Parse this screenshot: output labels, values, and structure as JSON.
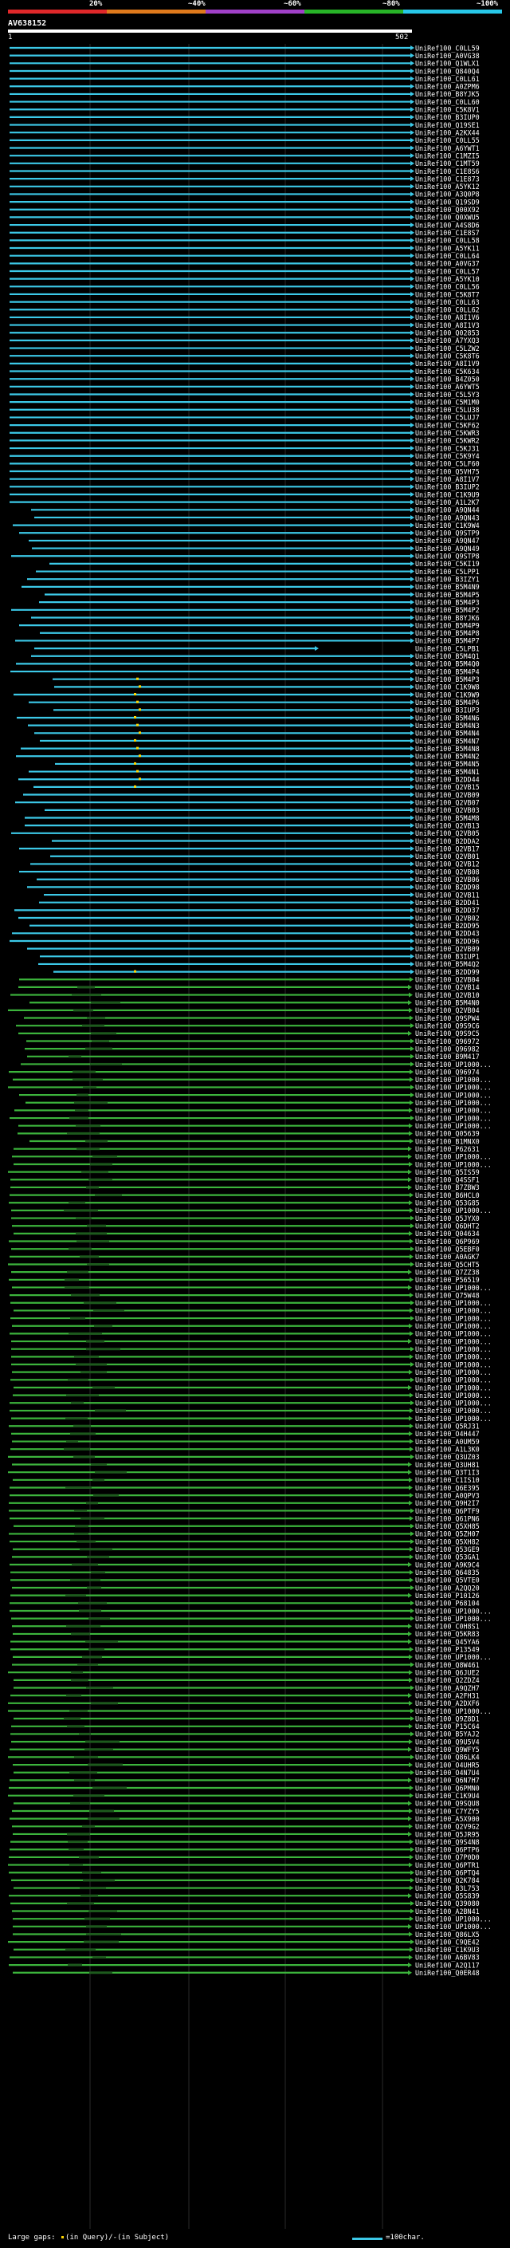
{
  "colorbar": {
    "ticks": [
      "20%",
      "~40%",
      "~60%",
      "~80%",
      "~100%"
    ],
    "colors": [
      "#e0282a",
      "#e07a1c",
      "#a040c8",
      "#28b428",
      "#28c8e8"
    ]
  },
  "query": {
    "title": "AV638152",
    "start": "1",
    "end": "502"
  },
  "colors": {
    "cyan": "#3cc9e8",
    "green": "#3cb43c",
    "dark_green": "#1d5a1d",
    "gap_dot": "#ffd700"
  },
  "hits": [
    "UniRef100_C0LL59",
    "UniRef100_A0VG38",
    "UniRef100_Q1WLX1",
    "UniRef100_Q840Q4",
    "UniRef100_C0LL61",
    "UniRef100_A0ZPM6",
    "UniRef100_B8YJK5",
    "UniRef100_C0LL60",
    "UniRef100_C5K8V1",
    "UniRef100_B3IUP0",
    "UniRef100_Q19SE1",
    "UniRef100_A2KX44",
    "UniRef100_C0LL55",
    "UniRef100_A6YWT1",
    "UniRef100_C1MZI5",
    "UniRef100_C1MT59",
    "UniRef100_C1E8S6",
    "UniRef100_C1E873",
    "UniRef100_A5YK12",
    "UniRef100_A3Q0P8",
    "UniRef100_Q19SD9",
    "UniRef100_Q00X92",
    "UniRef100_Q0XWU5",
    "UniRef100_A4S8D6",
    "UniRef100_C1E8S7",
    "UniRef100_C0LL58",
    "UniRef100_A5YK11",
    "UniRef100_C0LL64",
    "UniRef100_A0VG37",
    "UniRef100_C0LL57",
    "UniRef100_A5YK10",
    "UniRef100_C0LL56",
    "UniRef100_C5K8T7",
    "UniRef100_C0LL63",
    "UniRef100_C0LL62",
    "UniRef100_A8I1V6",
    "UniRef100_A8I1V3",
    "UniRef100_Q02853",
    "UniRef100_A7YXQ3",
    "UniRef100_C5LZW2",
    "UniRef100_C5K8T6",
    "UniRef100_A8I1V9",
    "UniRef100_C5K634",
    "UniRef100_B4Z050",
    "UniRef100_A6YWT5",
    "UniRef100_C5L5Y3",
    "UniRef100_C5M1M0",
    "UniRef100_C5LU38",
    "UniRef100_C5LUJ7",
    "UniRef100_C5KF62",
    "UniRef100_C5KWR3",
    "UniRef100_C5KWR2",
    "UniRef100_C5KJ31",
    "UniRef100_C5K9Y4",
    "UniRef100_C5LF60",
    "UniRef100_Q5VH75",
    "UniRef100_A8I1V7",
    "UniRef100_B3IUP2",
    "UniRef100_C1K9U9",
    "UniRef100_A1L2K7",
    "UniRef100_A9QN44",
    "UniRef100_A9QN43",
    "UniRef100_C1K9W4",
    "UniRef100_Q9STP9",
    "UniRef100_A9QN47",
    "UniRef100_A9QN49",
    "UniRef100_Q9STP8",
    "UniRef100_C5KI19",
    "UniRef100_C5LPP1",
    "UniRef100_B3IZY1",
    "UniRef100_B5M4N9",
    "UniRef100_B5M4P5",
    "UniRef100_B5M4P3",
    "UniRef100_B5M4P2",
    "UniRef100_B8YJK6",
    "UniRef100_B5M4P9",
    "UniRef100_B5M4P8",
    "UniRef100_B5M4P7",
    "UniRef100_C5LPB1",
    "UniRef100_B5M4Q1",
    "UniRef100_B5M4Q0",
    "UniRef100_B5M4P4",
    "UniRef100_B5M4P3",
    "UniRef100_C1K9W8",
    "UniRef100_C1K9W9",
    "UniRef100_B5M4P6",
    "UniRef100_B3IUP3",
    "UniRef100_B5M4N6",
    "UniRef100_B5M4N3",
    "UniRef100_B5M4N4",
    "UniRef100_B5M4N7",
    "UniRef100_B5M4N8",
    "UniRef100_B5M4N2",
    "UniRef100_B5M4N5",
    "UniRef100_B5M4N1",
    "UniRef100_B2DD44",
    "UniRef100_Q2VB15",
    "UniRef100_Q2VB09",
    "UniRef100_Q2VB07",
    "UniRef100_Q2VB03",
    "UniRef100_B5M4M8",
    "UniRef100_Q2VB13",
    "UniRef100_Q2VB05",
    "UniRef100_B2DDA2",
    "UniRef100_Q2VB17",
    "UniRef100_Q2VB01",
    "UniRef100_Q2VB12",
    "UniRef100_Q2VB08",
    "UniRef100_Q2VB06",
    "UniRef100_B2DD98",
    "UniRef100_Q2VB11",
    "UniRef100_B2DD41",
    "UniRef100_B2DD37",
    "UniRef100_Q2VB02",
    "UniRef100_B2DD95",
    "UniRef100_B2DD43",
    "UniRef100_B2DD96",
    "UniRef100_Q2VB09",
    "UniRef100_B3IUP1",
    "UniRef100_B5M4Q2",
    "UniRef100_B2DD99",
    "UniRef100_Q2VB04",
    "UniRef100_Q2VB14",
    "UniRef100_Q2VB10",
    "UniRef100_B5M4N0",
    "UniRef100_Q2VB04",
    "UniRef100_Q9SPW4",
    "UniRef100_Q9S9C6",
    "UniRef100_Q9S9C5",
    "UniRef100_Q96972",
    "UniRef100_Q96982",
    "UniRef100_B9M417",
    "UniRef100_UP1000...",
    "UniRef100_Q96974",
    "UniRef100_UP1000...",
    "UniRef100_UP1000...",
    "UniRef100_UP1000...",
    "UniRef100_UP1000...",
    "UniRef100_UP1000...",
    "UniRef100_UP1000...",
    "UniRef100_UP1000...",
    "UniRef100_Q05639",
    "UniRef100_B1MNX0",
    "UniRef100_P62631",
    "UniRef100_UP1000...",
    "UniRef100_UP1000...",
    "UniRef100_Q5IS59",
    "UniRef100_Q4SSF1",
    "UniRef100_B7ZBW3",
    "UniRef100_B6HCL0",
    "UniRef100_Q53G85",
    "UniRef100_UP1000...",
    "UniRef100_Q5JYX0",
    "UniRef100_Q6DHT2",
    "UniRef100_Q04634",
    "UniRef100_Q6P969",
    "UniRef100_Q5EBF0",
    "UniRef100_A0AGK7",
    "UniRef100_Q5CHT5",
    "UniRef100_Q7ZZ38",
    "UniRef100_P56519",
    "UniRef100_UP1000...",
    "UniRef100_Q75W48",
    "UniRef100_UP1000...",
    "UniRef100_UP1000...",
    "UniRef100_UP1000...",
    "UniRef100_UP1000...",
    "UniRef100_UP1000...",
    "UniRef100_UP1000...",
    "UniRef100_UP1000...",
    "UniRef100_UP1000...",
    "UniRef100_UP1000...",
    "UniRef100_UP1000...",
    "UniRef100_UP1000...",
    "UniRef100_UP1000...",
    "UniRef100_UP1000...",
    "UniRef100_UP1000...",
    "UniRef100_UP1000...",
    "UniRef100_UP1000...",
    "UniRef100_Q5RJ31",
    "UniRef100_O4H447",
    "UniRef100_A0UM59",
    "UniRef100_A1L3K0",
    "UniRef100_Q3UZ03",
    "UniRef100_Q3UH81",
    "UniRef100_Q3T1I3",
    "UniRef100_C1IS10",
    "UniRef100_Q6E395",
    "UniRef100_A0QPV3",
    "UniRef100_Q9H2I7",
    "UniRef100_Q6PTF9",
    "UniRef100_Q61PN6",
    "UniRef100_Q5XH85",
    "UniRef100_Q5ZH07",
    "UniRef100_Q5XH82",
    "UniRef100_Q53GE9",
    "UniRef100_Q53GA1",
    "UniRef100_A9K9C4",
    "UniRef100_Q64835",
    "UniRef100_Q5VTE0",
    "UniRef100_A2QQ20",
    "UniRef100_P10126",
    "UniRef100_P68104",
    "UniRef100_UP1000...",
    "UniRef100_UP1000...",
    "UniRef100_C0H8S1",
    "UniRef100_Q5KR83",
    "UniRef100_Q45YA6",
    "UniRef100_P13549",
    "UniRef100_UP1000...",
    "UniRef100_Q8W461",
    "UniRef100_Q6JUE2",
    "UniRef100_Q2ZDZ4",
    "UniRef100_A9QZH7",
    "UniRef100_A2FH31",
    "UniRef100_A2DXF6",
    "UniRef100_UP1000...",
    "UniRef100_Q9Z8D1",
    "UniRef100_P15C64",
    "UniRef100_B5YAJ2",
    "UniRef100_Q9U5V4",
    "UniRef100_Q9WFY5",
    "UniRef100_Q86LK4",
    "UniRef100_O4UHR5",
    "UniRef100_O4N7U4",
    "UniRef100_Q6N7H7",
    "UniRef100_Q6PMN0",
    "UniRef100_C1K9U4",
    "UniRef100_Q9SQU8",
    "UniRef100_C7YZY5",
    "UniRef100_A5X900",
    "UniRef100_Q2V9G2",
    "UniRef100_Q5JR95",
    "UniRef100_Q9S4N8",
    "UniRef100_Q6PTP6",
    "UniRef100_Q7P0D0",
    "UniRef100_Q6PTR1",
    "UniRef100_Q6PTQ4",
    "UniRef100_Q2K784",
    "UniRef100_B3L753",
    "UniRef100_Q5S839",
    "UniRef100_Q39080",
    "UniRef100_A2BN41",
    "UniRef100_UP1000...",
    "UniRef100_UP1000...",
    "UniRef100_Q86LX5",
    "UniRef100_C9QE42",
    "UniRef100_C1K9U3",
    "UniRef100_A6BV83",
    "UniRef100_A2Q117",
    "UniRef100_Q0ER48"
  ],
  "footer": {
    "gaps_label": "Large gaps:",
    "gaps_query": "(in Query)/",
    "gaps_subject": "(in Subject)",
    "scale_label": "=100char."
  }
}
